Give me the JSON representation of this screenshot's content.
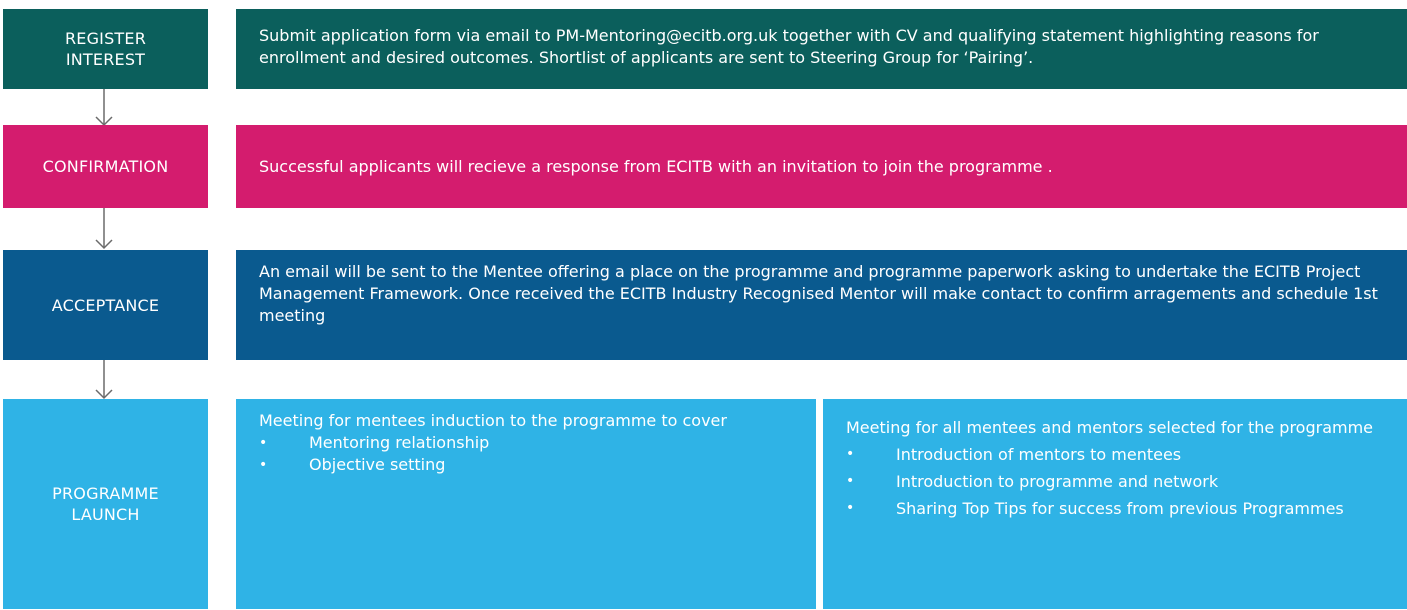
{
  "colors": {
    "register": "#0b5f5c",
    "confirmation": "#d41c6e",
    "acceptance": "#0a5a8f",
    "launch": "#2fb3e6",
    "arrow": "#6b6b6b"
  },
  "steps": {
    "register": {
      "label": "REGISTER INTEREST",
      "text": "Submit application form via email to PM-Mentoring@ecitb.org.uk together with CV and qualifying statement highlighting reasons for enrollment and desired outcomes.  Shortlist of applicants are sent to Steering Group for ‘Pairing’."
    },
    "confirmation": {
      "label": "CONFIRMATION",
      "text": "Successful applicants will recieve a response from ECITB with an invitation to join the programme ."
    },
    "acceptance": {
      "label": "ACCEPTANCE",
      "text": "An email will be sent to the Mentee offering a place on the programme and programme paperwork asking to undertake the ECITB Project Management Framework. Once received the ECITB Industry Recognised Mentor will make contact to confirm arragements and schedule 1st meeting"
    },
    "launch": {
      "label": "PROGRAMME LAUNCH",
      "left": {
        "intro": "Meeting for mentees induction to the programme to cover",
        "items": [
          "Mentoring relationship",
          "Objective setting"
        ]
      },
      "right": {
        "intro": "Meeting for all mentees and mentors selected for the programme",
        "items": [
          "Introduction of mentors to mentees",
          "Introduction to programme and network",
          "Sharing Top Tips for success from previous Programmes"
        ]
      }
    }
  },
  "arrows": [
    "down-arrow-icon",
    "down-arrow-icon",
    "down-arrow-icon"
  ]
}
